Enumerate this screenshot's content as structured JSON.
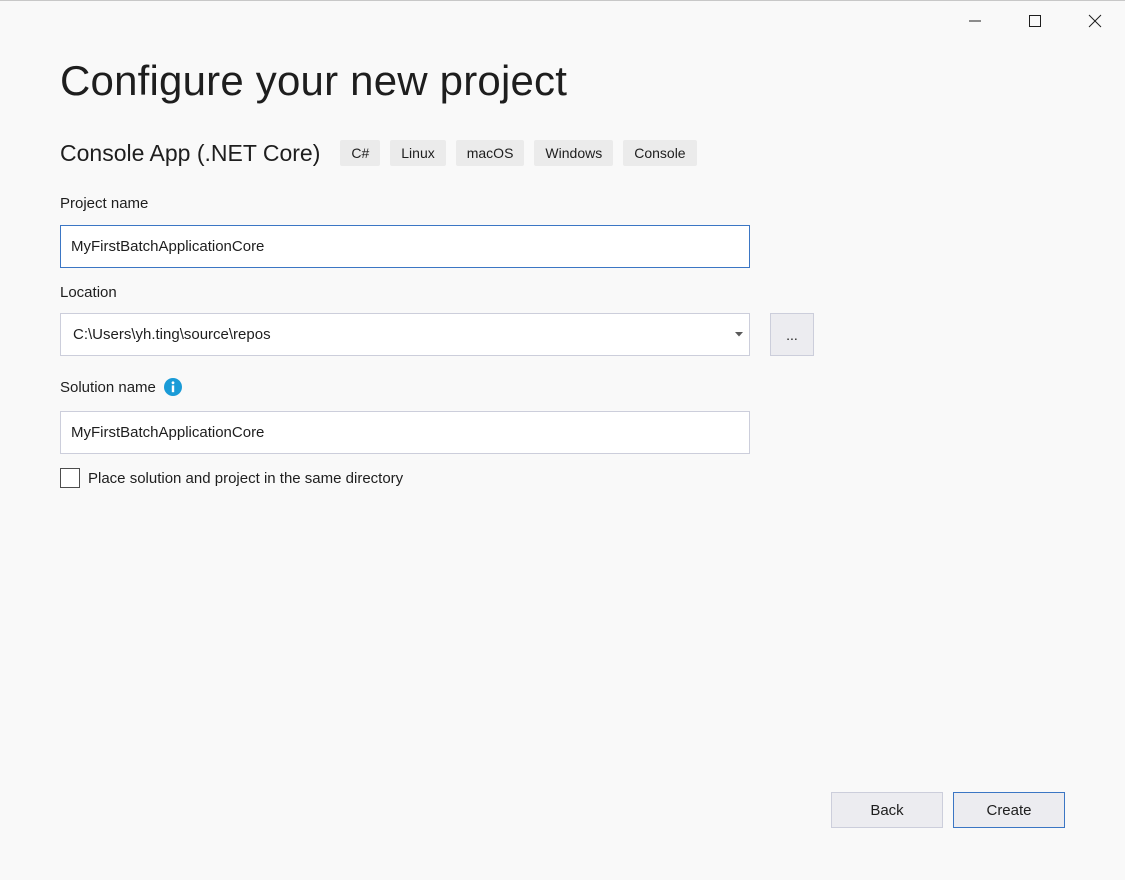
{
  "window_controls": {
    "minimize": "minimize-icon",
    "maximize": "maximize-icon",
    "close": "close-icon"
  },
  "page": {
    "title": "Configure your new project"
  },
  "template": {
    "name": "Console App (.NET Core)",
    "tags": [
      "C#",
      "Linux",
      "macOS",
      "Windows",
      "Console"
    ]
  },
  "project_name": {
    "label": "Project name",
    "value": "MyFirstBatchApplicationCore"
  },
  "location": {
    "label": "Location",
    "value": "C:\\Users\\yh.ting\\source\\repos",
    "browse_label": "..."
  },
  "solution_name": {
    "label": "Solution name",
    "value": "MyFirstBatchApplicationCore",
    "info_icon": "info-icon"
  },
  "same_directory": {
    "label": "Place solution and project in the same directory",
    "checked": false
  },
  "buttons": {
    "back": "Back",
    "create": "Create"
  },
  "colors": {
    "accent_border": "#3b76c4",
    "info_blue": "#1a9bd7",
    "background": "#f9f9f9"
  }
}
